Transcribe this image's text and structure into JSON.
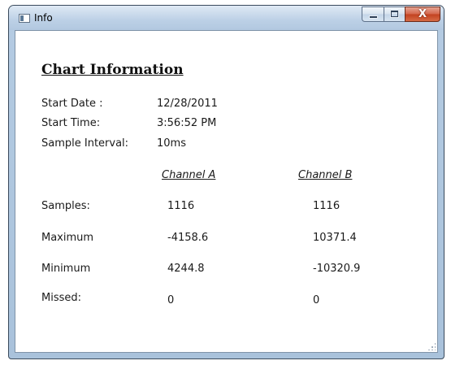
{
  "window": {
    "title": "Info",
    "buttons": {
      "close_glyph": "X"
    }
  },
  "content": {
    "heading": "Chart Information",
    "info": [
      {
        "label": "Start Date :",
        "value": "12/28/2011"
      },
      {
        "label": "Start Time:",
        "value": "3:56:52 PM"
      },
      {
        "label": "Sample Interval:",
        "value": "10ms"
      }
    ],
    "channels": [
      "Channel A",
      "Channel B"
    ],
    "stats": [
      {
        "label": "Samples:",
        "a": "1116",
        "b": "1116"
      },
      {
        "label": "Maximum",
        "a": "-4158.6",
        "b": "10371.4"
      },
      {
        "label": "Minimum",
        "a": "4244.8",
        "b": "-10320.9"
      },
      {
        "label": "Missed:",
        "a": "0",
        "b": "0"
      }
    ]
  }
}
